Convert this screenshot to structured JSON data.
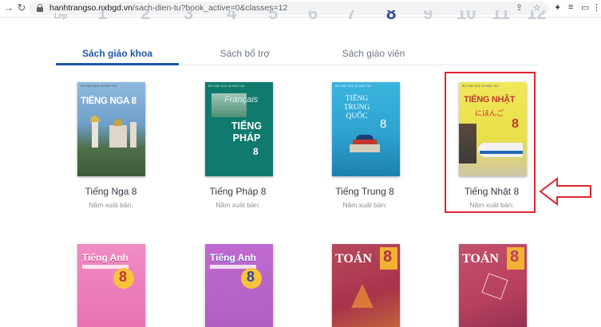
{
  "browser": {
    "url_host": "hanhtrangso.nxbgd.vn",
    "url_path": "/sach-dien-tu?book_active=0&classes=12"
  },
  "grades": {
    "label": "Lớp",
    "numbers": [
      "1",
      "2",
      "3",
      "4",
      "5",
      "6",
      "7",
      "8",
      "9",
      "10",
      "11",
      "12"
    ],
    "active": "8"
  },
  "tabs": [
    {
      "label": "Sách giáo khoa",
      "active": true
    },
    {
      "label": "Sách bổ trợ",
      "active": false
    },
    {
      "label": "Sách giáo viên",
      "active": false
    }
  ],
  "books_row1": [
    {
      "title": "Tiếng Nga 8",
      "year_label": "Năm xuất bản:",
      "cover_text": "TIẾNG NGA 8",
      "cover_color": "#6f9fc9"
    },
    {
      "title": "Tiếng Pháp 8",
      "year_label": "Năm xuất bản:",
      "cover_text": "TIẾNG PHÁP",
      "cover_sub": "Français",
      "cover_num": "8",
      "cover_color": "#0f7a6d"
    },
    {
      "title": "Tiếng Trung 8",
      "year_label": "Năm xuất bản:",
      "cover_text": "TIẾNG TRUNG QUỐC",
      "cover_num": "8",
      "cover_color": "#2ea3cf"
    },
    {
      "title": "Tiếng Nhật 8",
      "year_label": "Năm xuất bản:",
      "cover_text": "TIẾNG NHẬT",
      "cover_sub": "にほんご",
      "cover_num": "8",
      "cover_color": "#e9df4a"
    }
  ],
  "books_row2": [
    {
      "cover_text": "Tiếng Anh",
      "cover_num": "8",
      "cover_color": "#e86fb0"
    },
    {
      "cover_text": "Tiếng Anh",
      "cover_num": "8",
      "cover_color": "#b05cc0"
    },
    {
      "cover_text": "TOÁN",
      "cover_num": "8",
      "cover_color": "#a8334a"
    },
    {
      "cover_text": "TOÁN",
      "cover_num": "8",
      "cover_color": "#b7405f"
    }
  ],
  "colors": {
    "accent": "#1f56a8",
    "highlight": "#e0262f"
  }
}
